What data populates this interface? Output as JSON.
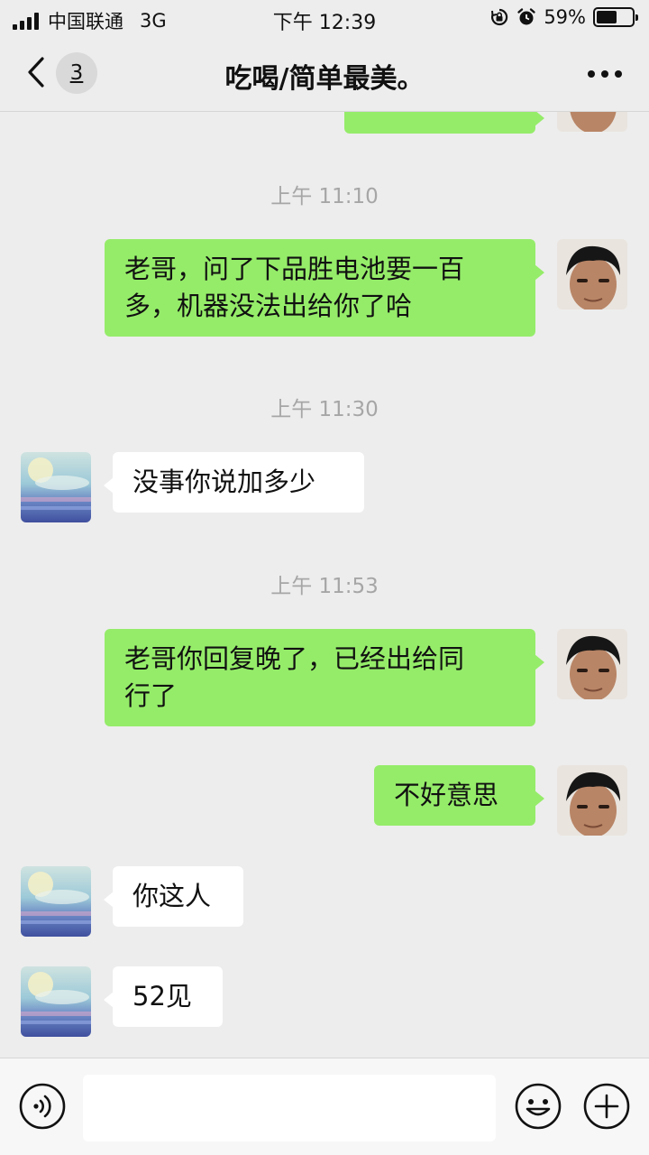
{
  "status_bar": {
    "carrier": "中国联通",
    "network": "3G",
    "time": "下午 12:39",
    "battery_percent": "59%",
    "battery_level": 0.59,
    "icons": [
      "signal-icon",
      "orientation-lock-icon",
      "alarm-icon",
      "battery-icon"
    ]
  },
  "nav": {
    "back_icon": "chevron-left-icon",
    "unread_count": "3",
    "title": "吃喝/简单最美。",
    "more_icon": "more-dots-icon"
  },
  "messages": [
    {
      "type": "timestamp",
      "text": "上午 11:10"
    },
    {
      "type": "message",
      "side": "out",
      "lines": [
        "老哥，问了下品胜电池要一百",
        "多，机器没法出给你了哈"
      ]
    },
    {
      "type": "timestamp",
      "text": "上午 11:30"
    },
    {
      "type": "message",
      "side": "in",
      "lines": [
        "没事你说加多少"
      ]
    },
    {
      "type": "timestamp",
      "text": "上午 11:53"
    },
    {
      "type": "message",
      "side": "out",
      "lines": [
        "老哥你回复晚了，已经出给同",
        "行了"
      ]
    },
    {
      "type": "message",
      "side": "out",
      "lines": [
        "不好意思"
      ]
    },
    {
      "type": "message",
      "side": "in",
      "lines": [
        "你这人"
      ]
    },
    {
      "type": "message",
      "side": "in",
      "lines": [
        "52见"
      ]
    }
  ],
  "input_bar": {
    "voice_icon": "voice-icon",
    "text_value": "",
    "emoji_icon": "emoji-icon",
    "plus_icon": "plus-icon"
  },
  "colors": {
    "background": "#ededed",
    "outgoing_bubble": "#95ec69",
    "incoming_bubble": "#ffffff",
    "timestamp_text": "#a6a6a6"
  }
}
